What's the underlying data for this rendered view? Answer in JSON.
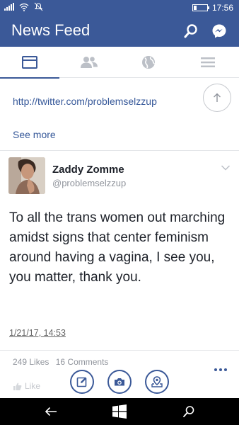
{
  "status_bar": {
    "time": "17:56",
    "icons": [
      "signal-icon",
      "wifi-icon",
      "quiet-hours-icon",
      "battery-icon"
    ]
  },
  "header": {
    "title": "News Feed",
    "icons": [
      "search-icon",
      "messenger-icon"
    ],
    "color": "#3b5998"
  },
  "tabs": [
    {
      "name": "news-feed-tab",
      "icon": "feed-icon",
      "selected": true
    },
    {
      "name": "friends-tab",
      "icon": "friends-icon",
      "selected": false
    },
    {
      "name": "notifications-tab",
      "icon": "globe-icon",
      "selected": false
    },
    {
      "name": "menu-tab",
      "icon": "hamburger-icon",
      "selected": false
    }
  ],
  "post": {
    "link": "http://twitter.com/problemselzzup",
    "see_more": "See more",
    "tweet": {
      "author_name": "Zaddy Zomme",
      "author_handle": "@problemselzzup",
      "text": "To all the trans women out marching amidst signs that center feminism around having a vagina, I see you, you matter, thank you.",
      "date": "1/21/17, 14:53"
    },
    "likes": "249 Likes",
    "comments": "16 Comments",
    "like_action": "Like"
  },
  "bottom_actions": [
    "compose-icon",
    "camera-icon",
    "check-in-icon"
  ],
  "nav": [
    "back-icon",
    "windows-icon",
    "search-icon"
  ]
}
